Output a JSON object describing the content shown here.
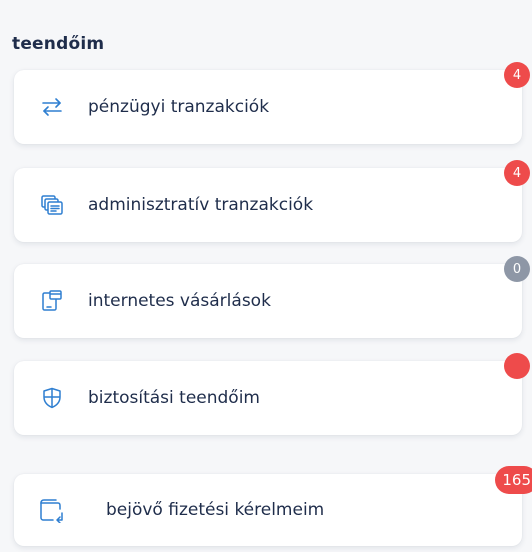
{
  "section": {
    "title": "teendőim"
  },
  "items": [
    {
      "label": "pénzügyi tranzakciók",
      "icon": "transfer-arrows-icon",
      "badge": "4",
      "badge_color": "#ee4b4b"
    },
    {
      "label": "adminisztratív tranzakciók",
      "icon": "documents-stack-icon",
      "badge": "4",
      "badge_color": "#ee4b4b"
    },
    {
      "label": "internetes vásárlások",
      "icon": "device-card-icon",
      "badge": "0",
      "badge_color": "#8e97a6"
    },
    {
      "label": "biztosítási teendőim",
      "icon": "shield-icon",
      "badge": "",
      "badge_color": "#ee4b4b"
    },
    {
      "label": "bejövő fizetési kérelmeim",
      "icon": "wallet-incoming-icon",
      "badge": "165",
      "badge_color": "#ee4b4b"
    }
  ],
  "colors": {
    "accent": "#2f7fd1",
    "text": "#1f2d4b"
  }
}
